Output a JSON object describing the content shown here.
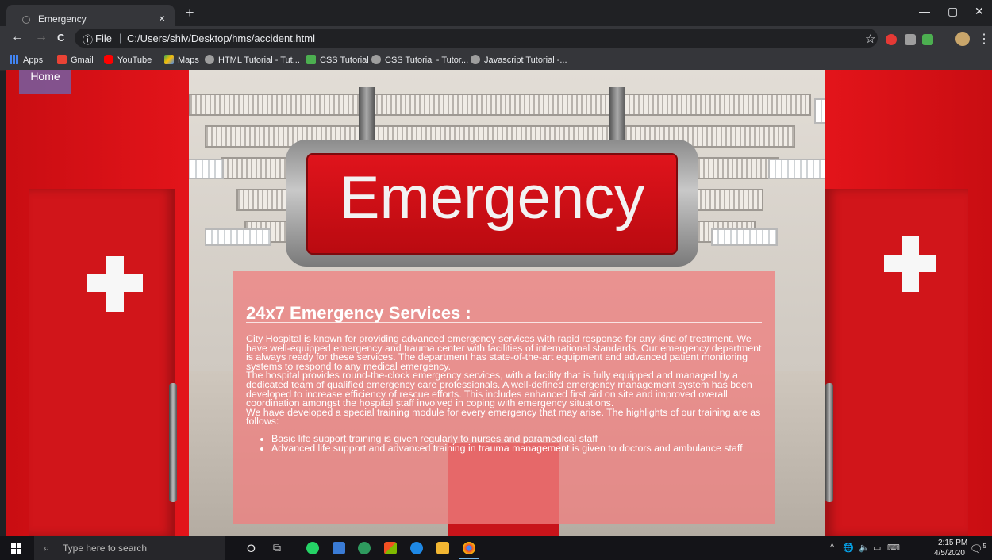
{
  "browser": {
    "tab_title": "Emergency",
    "tab_close": "×",
    "new_tab": "+",
    "window_controls": {
      "minimize": "—",
      "maximize": "▢",
      "close": "✕"
    },
    "nav": {
      "back": "←",
      "forward": "→",
      "reload": "C"
    },
    "omnibox": {
      "info": "ⓘ",
      "scheme_label": "File",
      "separator": "|",
      "url": "C:/Users/shiv/Desktop/hms/accident.html"
    },
    "star": "☆",
    "menu": "⋮"
  },
  "bookmarks": [
    {
      "label": "Apps",
      "icon": "apps-grid-icon",
      "color": "#4285f4"
    },
    {
      "label": "Gmail",
      "icon": "gmail-icon",
      "color": "#ea4335"
    },
    {
      "label": "YouTube",
      "icon": "youtube-icon",
      "color": "#ff0000"
    },
    {
      "label": "Maps",
      "icon": "maps-icon",
      "color": "#34a853"
    },
    {
      "label": "HTML Tutorial - Tut...",
      "icon": "w3schools-icon",
      "color": "#9e9e9e"
    },
    {
      "label": "CSS Tutorial",
      "icon": "w3schools-green-icon",
      "color": "#4caf50"
    },
    {
      "label": "CSS Tutorial - Tutor...",
      "icon": "tutorialspoint-icon",
      "color": "#9e9e9e"
    },
    {
      "label": "Javascript Tutorial -...",
      "icon": "tutorialspoint-icon",
      "color": "#9e9e9e"
    }
  ],
  "page": {
    "home_label": "Home",
    "sign_text": "Emergency",
    "services": {
      "title": "24x7 Emergency Services :",
      "paragraphs": [
        "City Hospital is known for providing advanced emergency services with rapid response for any kind of treatment. We have well-equipped emergency and trauma center with facilities of international standards. Our emergency department is always ready for these services. The department has state-of-the-art equipment and advanced patient monitoring systems to respond to any medical emergency.",
        "The hospital provides round-the-clock emergency services, with a facility that is fully equipped and managed by a dedicated team of qualified emergency care professionals. A well-defined emergency management system has been developed to increase efficiency of rescue efforts. This includes enhanced first aid on site and improved overall coordination amongst the hospital staff involved in coping with emergency situations.",
        "We have developed a special training module for every emergency that may arise. The highlights of our training are as follows:"
      ],
      "list": [
        "Basic life support training is given regularly to nurses and paramedical staff",
        "Advanced life support and advanced training in trauma management is given to doctors and ambulance staff"
      ]
    }
  },
  "taskbar": {
    "search_glyph": "⌕",
    "search_placeholder": "Type here to search",
    "cortana": "O",
    "task_view": "⧉",
    "time": "2:15 PM",
    "date": "4/5/2020",
    "tray_chevron": "^",
    "notification_count": "5"
  },
  "colors": {
    "brand_red": "#d1151a",
    "panel": "#ee8080",
    "browser_dark": "#202124"
  }
}
